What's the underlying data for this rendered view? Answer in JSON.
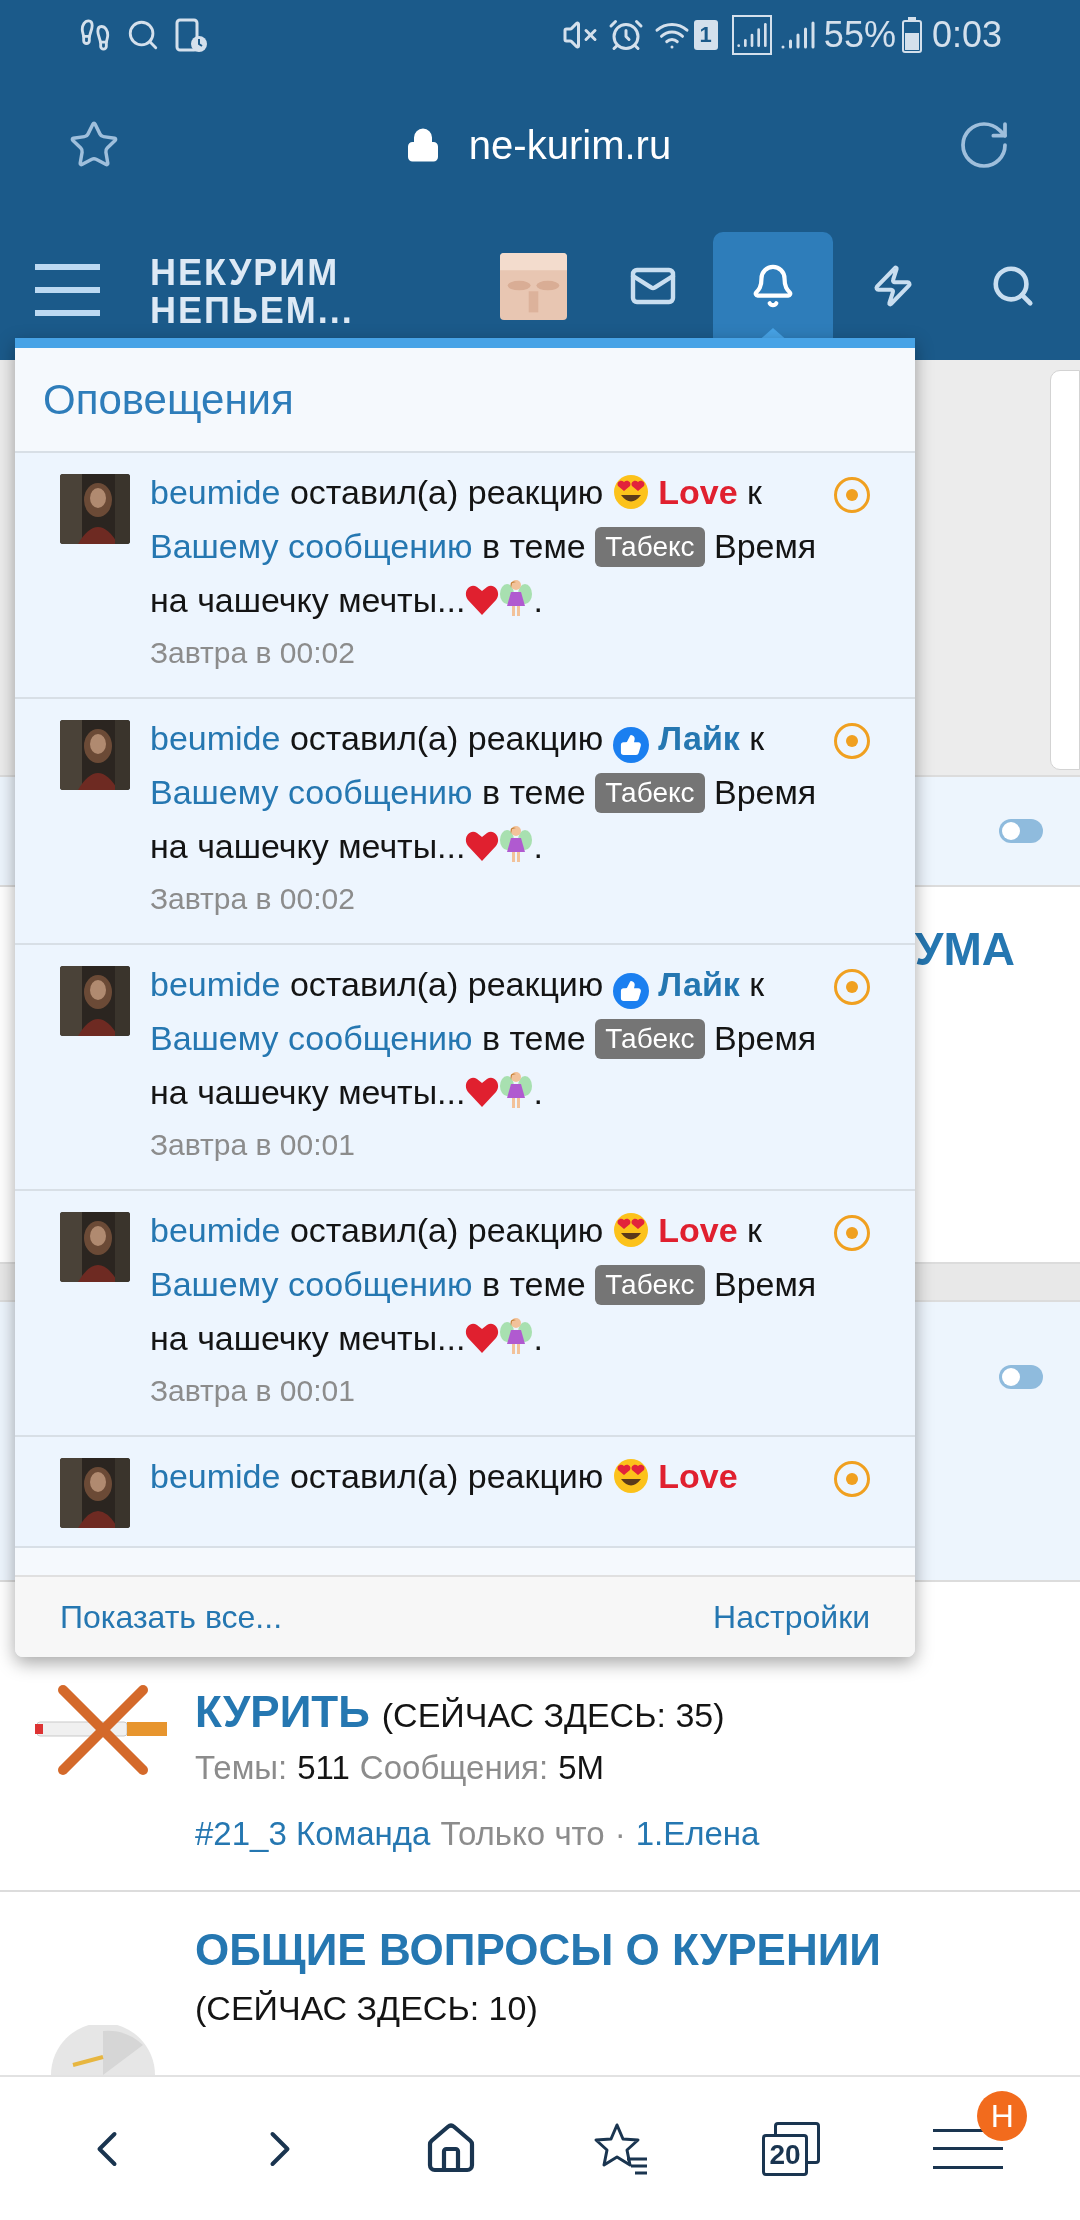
{
  "status_bar": {
    "sim": "1",
    "battery": "55%",
    "time": "0:03"
  },
  "browser": {
    "url": "ne-kurim.ru"
  },
  "header": {
    "logo": [
      "НЕКУРИМ",
      "НЕПЬЕМ..."
    ],
    "nav": [
      {
        "kind": "avatar",
        "selected": false
      },
      {
        "kind": "mail",
        "selected": false
      },
      {
        "kind": "bell",
        "selected": true
      },
      {
        "kind": "bolt",
        "selected": false
      },
      {
        "kind": "search",
        "selected": false
      }
    ]
  },
  "background": {
    "toggles": [
      {
        "on": false
      },
      {
        "on": false
      }
    ],
    "heading_fragment": "УМА",
    "forums": [
      {
        "kind": "no-smoking",
        "title": "КУРИТЬ",
        "online": "(СЕЙЧАС ЗДЕСЬ: 35)",
        "stats": [
          {
            "label": "Темы:",
            "value": "511"
          },
          {
            "label": "Сообщения:",
            "value": "5M"
          }
        ],
        "last_post": {
          "thread": "#21_3 Команда",
          "time": "Только что",
          "separator": "·",
          "user": "1.Елена"
        }
      },
      {
        "kind": "clock",
        "title": "ОБЩИЕ ВОПРОСЫ О КУРЕНИИ",
        "online": "(СЕЙЧАС ЗДЕСЬ: 10)"
      }
    ]
  },
  "notifications": {
    "title": "Оповещения",
    "items": [
      {
        "unread": true,
        "time": "Завтра в 00:02",
        "parts": [
          {
            "kind": "user",
            "text": "beumide"
          },
          {
            "kind": "text",
            "text": "оставил(а) реакцию"
          },
          {
            "kind": "love",
            "text": "Love"
          },
          {
            "kind": "text",
            "text": "к"
          },
          {
            "kind": "link",
            "text": "Вашему сообщению"
          },
          {
            "kind": "text",
            "text": "в теме"
          },
          {
            "kind": "tag",
            "text": "Табекс"
          },
          {
            "kind": "text",
            "text": "Время на чашечку мечты..."
          },
          {
            "kind": "heart"
          },
          {
            "kind": "fairy"
          },
          {
            "kind": "punct",
            "text": "."
          }
        ]
      },
      {
        "unread": true,
        "time": "Завтра в 00:02",
        "parts": [
          {
            "kind": "user",
            "text": "beumide"
          },
          {
            "kind": "text",
            "text": "оставил(а) реакцию"
          },
          {
            "kind": "like",
            "text": "Лайк"
          },
          {
            "kind": "text",
            "text": "к"
          },
          {
            "kind": "link",
            "text": "Вашему сообщению"
          },
          {
            "kind": "text",
            "text": "в теме"
          },
          {
            "kind": "tag",
            "text": "Табекс"
          },
          {
            "kind": "text",
            "text": "Время на чашечку мечты..."
          },
          {
            "kind": "heart"
          },
          {
            "kind": "fairy"
          },
          {
            "kind": "punct",
            "text": "."
          }
        ]
      },
      {
        "unread": true,
        "time": "Завтра в 00:01",
        "parts": [
          {
            "kind": "user",
            "text": "beumide"
          },
          {
            "kind": "text",
            "text": "оставил(а) реакцию"
          },
          {
            "kind": "like",
            "text": "Лайк"
          },
          {
            "kind": "text",
            "text": "к"
          },
          {
            "kind": "link",
            "text": "Вашему сообщению"
          },
          {
            "kind": "text",
            "text": "в теме"
          },
          {
            "kind": "tag",
            "text": "Табекс"
          },
          {
            "kind": "text",
            "text": "Время на чашечку мечты..."
          },
          {
            "kind": "heart"
          },
          {
            "kind": "fairy"
          },
          {
            "kind": "punct",
            "text": "."
          }
        ]
      },
      {
        "unread": true,
        "time": "Завтра в 00:01",
        "parts": [
          {
            "kind": "user",
            "text": "beumide"
          },
          {
            "kind": "text",
            "text": "оставил(а) реакцию"
          },
          {
            "kind": "love",
            "text": "Love"
          },
          {
            "kind": "text",
            "text": "к"
          },
          {
            "kind": "link",
            "text": "Вашему сообщению"
          },
          {
            "kind": "text",
            "text": "в теме"
          },
          {
            "kind": "tag",
            "text": "Табекс"
          },
          {
            "kind": "text",
            "text": "Время на чашечку мечты..."
          },
          {
            "kind": "heart"
          },
          {
            "kind": "fairy"
          },
          {
            "kind": "punct",
            "text": "."
          }
        ]
      },
      {
        "unread": true,
        "parts": [
          {
            "kind": "user",
            "text": "beumide"
          },
          {
            "kind": "text",
            "text": "оставил(а) реакцию"
          },
          {
            "kind": "love",
            "text": "Love"
          }
        ]
      }
    ],
    "footer": {
      "show_all": "Показать все...",
      "settings": "Настройки"
    }
  },
  "bottom_bar": {
    "tabs_count": "20",
    "menu_badge": "Н"
  }
}
